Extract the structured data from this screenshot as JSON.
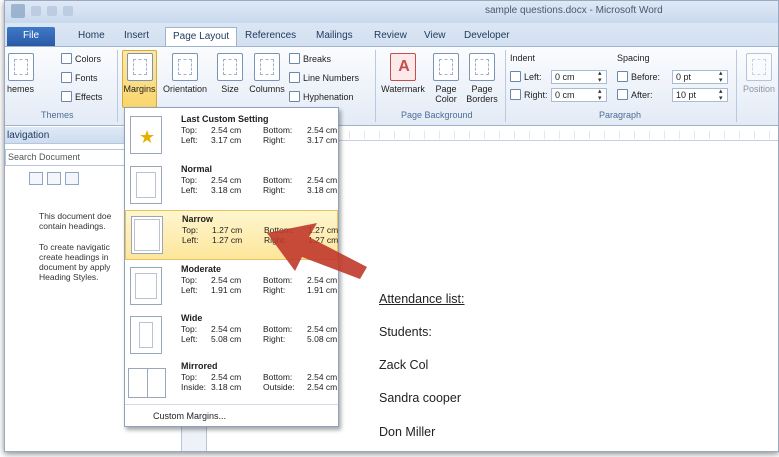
{
  "window": {
    "title": "sample questions.docx - Microsoft Word"
  },
  "tabs": [
    "File",
    "Home",
    "Insert",
    "Page Layout",
    "References",
    "Mailings",
    "Review",
    "View",
    "Developer"
  ],
  "active_tab": "Page Layout",
  "ribbon": {
    "themes": {
      "themes_label": "hemes",
      "colors": "Colors",
      "fonts": "Fonts",
      "effects": "Effects",
      "group": "Themes"
    },
    "page_setup": {
      "margins": "Margins",
      "orientation": "Orientation",
      "size": "Size",
      "columns": "Columns",
      "breaks": "Breaks",
      "line_numbers": "Line Numbers",
      "hyphenation": "Hyphenation"
    },
    "page_background": {
      "watermark": "Watermark",
      "page_color_1": "Page",
      "page_color_2": "Color",
      "page_borders_1": "Page",
      "page_borders_2": "Borders",
      "group": "Page Background"
    },
    "paragraph": {
      "indent": "Indent",
      "left_label": "Left:",
      "left_value": "0 cm",
      "right_label": "Right:",
      "right_value": "0 cm",
      "spacing": "Spacing",
      "before_label": "Before:",
      "before_value": "0 pt",
      "after_label": "After:",
      "after_value": "10 pt",
      "group": "Paragraph"
    },
    "arrange": {
      "position": "Position"
    }
  },
  "nav_pane": {
    "title": "lavigation",
    "search_placeholder": "Search Document",
    "message_1": "This document doe\ncontain headings.",
    "message_2": "To create navigatic\ncreate headings in\ndocument by apply\nHeading Styles."
  },
  "margins_menu": {
    "items": [
      {
        "name": "Last Custom Setting",
        "top_label": "Top:",
        "top": "2.54 cm",
        "bottom_label": "Bottom:",
        "bottom": "2.54 cm",
        "left_label": "Left:",
        "left": "3.17 cm",
        "right_label": "Right:",
        "right": "3.17 cm"
      },
      {
        "name": "Normal",
        "top_label": "Top:",
        "top": "2.54 cm",
        "bottom_label": "Bottom:",
        "bottom": "2.54 cm",
        "left_label": "Left:",
        "left": "3.18 cm",
        "right_label": "Right:",
        "right": "3.18 cm"
      },
      {
        "name": "Narrow",
        "top_label": "Top:",
        "top": "1.27 cm",
        "bottom_label": "Bottom:",
        "bottom": "1.27 cm",
        "left_label": "Left:",
        "left": "1.27 cm",
        "right_label": "Right:",
        "right": "1.27 cm"
      },
      {
        "name": "Moderate",
        "top_label": "Top:",
        "top": "2.54 cm",
        "bottom_label": "Bottom:",
        "bottom": "2.54 cm",
        "left_label": "Left:",
        "left": "1.91 cm",
        "right_label": "Right:",
        "right": "1.91 cm"
      },
      {
        "name": "Wide",
        "top_label": "Top:",
        "top": "2.54 cm",
        "bottom_label": "Bottom:",
        "bottom": "2.54 cm",
        "left_label": "Left:",
        "left": "5.08 cm",
        "right_label": "Right:",
        "right": "5.08 cm"
      },
      {
        "name": "Mirrored",
        "top_label": "Top:",
        "top": "2.54 cm",
        "bottom_label": "Bottom:",
        "bottom": "2.54 cm",
        "left_label": "Inside:",
        "left": "3.18 cm",
        "right_label": "Outside:",
        "right": "2.54 cm"
      }
    ],
    "custom": "Custom Margins..."
  },
  "document": {
    "lines": [
      "Attendance list:",
      "Students:",
      "Zack Col",
      "Sandra cooper",
      "Don Miller"
    ]
  },
  "colors": {
    "accent": "#2b5797",
    "highlight": "#fde69b",
    "arrow": "#c0392b"
  }
}
